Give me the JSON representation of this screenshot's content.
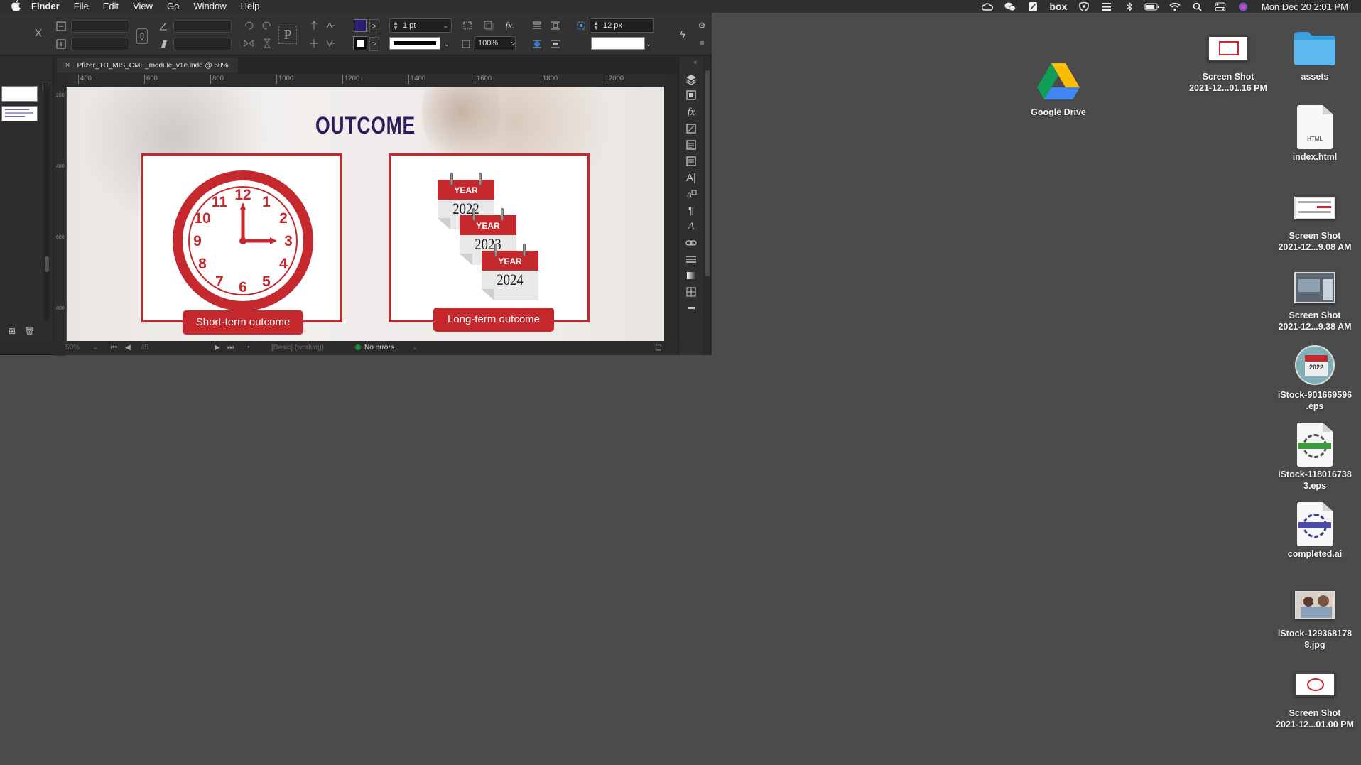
{
  "menubar": {
    "app_name": "Finder",
    "menus": [
      "File",
      "Edit",
      "View",
      "Go",
      "Window",
      "Help"
    ],
    "status_icons": [
      "creative-cloud-icon",
      "wechat-icon",
      "notes-app-icon",
      "box-icon",
      "vpn-shield-icon",
      "media-icon",
      "bluetooth-icon",
      "battery-icon",
      "wifi-icon",
      "spotlight-search-icon",
      "control-center-icon",
      "siri-icon"
    ],
    "box_label": "box",
    "clock": "Mon Dec 20  2:01 PM"
  },
  "indesign": {
    "control_panel": {
      "stroke_weight": "1 pt",
      "opacity": "100%",
      "gap": "12 px",
      "fill_color": "#2b1d6e"
    },
    "document_tab": {
      "close_glyph": "×",
      "title": "Pfizer_TH_MIS_CME_module_v1e.indd @ 50%"
    },
    "ruler_marks": [
      "400",
      "600",
      "800",
      "1000",
      "1200",
      "1400",
      "1600",
      "1800",
      "2000"
    ],
    "vertical_ruler_marks": [
      "200",
      "400",
      "600",
      "800"
    ],
    "slide": {
      "title": "OUTCOME",
      "short_term_label": "Short-term outcome",
      "long_term_label": "Long-term outcome",
      "clock_numbers": [
        "12",
        "1",
        "2",
        "3",
        "4",
        "5",
        "6",
        "7",
        "8",
        "9",
        "10",
        "11"
      ],
      "calendars": [
        {
          "header": "YEAR",
          "year": "2022"
        },
        {
          "header": "YEAR",
          "year": "2023"
        },
        {
          "header": "YEAR",
          "year": "2024"
        }
      ],
      "accent_color": "#c5282d",
      "title_color": "#2b1d5c"
    },
    "status_bar": {
      "zoom": "50%",
      "page": "45",
      "preflight_profile": "[Basic] (working)",
      "errors": "No errors"
    }
  },
  "desktop": {
    "items": [
      {
        "label_1": "Google Drive",
        "label_2": ""
      },
      {
        "label_1": "Screen Shot",
        "label_2": "2021-12...01.16 PM"
      },
      {
        "label_1": "assets",
        "label_2": ""
      },
      {
        "label_1": "index.html",
        "label_2": "",
        "badge": "HTML"
      },
      {
        "label_1": "Screen Shot",
        "label_2": "2021-12...9.08 AM"
      },
      {
        "label_1": "Screen Shot",
        "label_2": "2021-12...9.38 AM"
      },
      {
        "label_1": "iStock-901669596",
        "label_2": ".eps",
        "badge": "2022"
      },
      {
        "label_1": "iStock-118016738",
        "label_2": "3.eps"
      },
      {
        "label_1": "completed.ai",
        "label_2": ""
      },
      {
        "label_1": "iStock-129368178",
        "label_2": "8.jpg"
      },
      {
        "label_1": "Screen Shot",
        "label_2": "2021-12...01.00 PM"
      }
    ]
  }
}
